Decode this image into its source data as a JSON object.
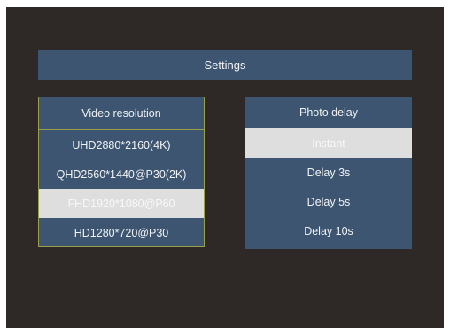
{
  "title": "Settings",
  "video_resolution": {
    "header": "Video resolution",
    "options": [
      {
        "label": "UHD2880*2160(4K)",
        "selected": false
      },
      {
        "label": "QHD2560*1440@P30(2K)",
        "selected": false
      },
      {
        "label": "FHD1920*1080@P60",
        "selected": true
      },
      {
        "label": "HD1280*720@P30",
        "selected": false
      }
    ]
  },
  "photo_delay": {
    "header": "Photo delay",
    "options": [
      {
        "label": "Instant",
        "selected": true
      },
      {
        "label": "Delay 3s",
        "selected": false
      },
      {
        "label": "Delay 5s",
        "selected": false
      },
      {
        "label": "Delay 10s",
        "selected": false
      }
    ]
  },
  "colors": {
    "background": "#2e2927",
    "panel": "#3d5570",
    "selected": "#dedede",
    "focus_border": "#9aa04a"
  }
}
